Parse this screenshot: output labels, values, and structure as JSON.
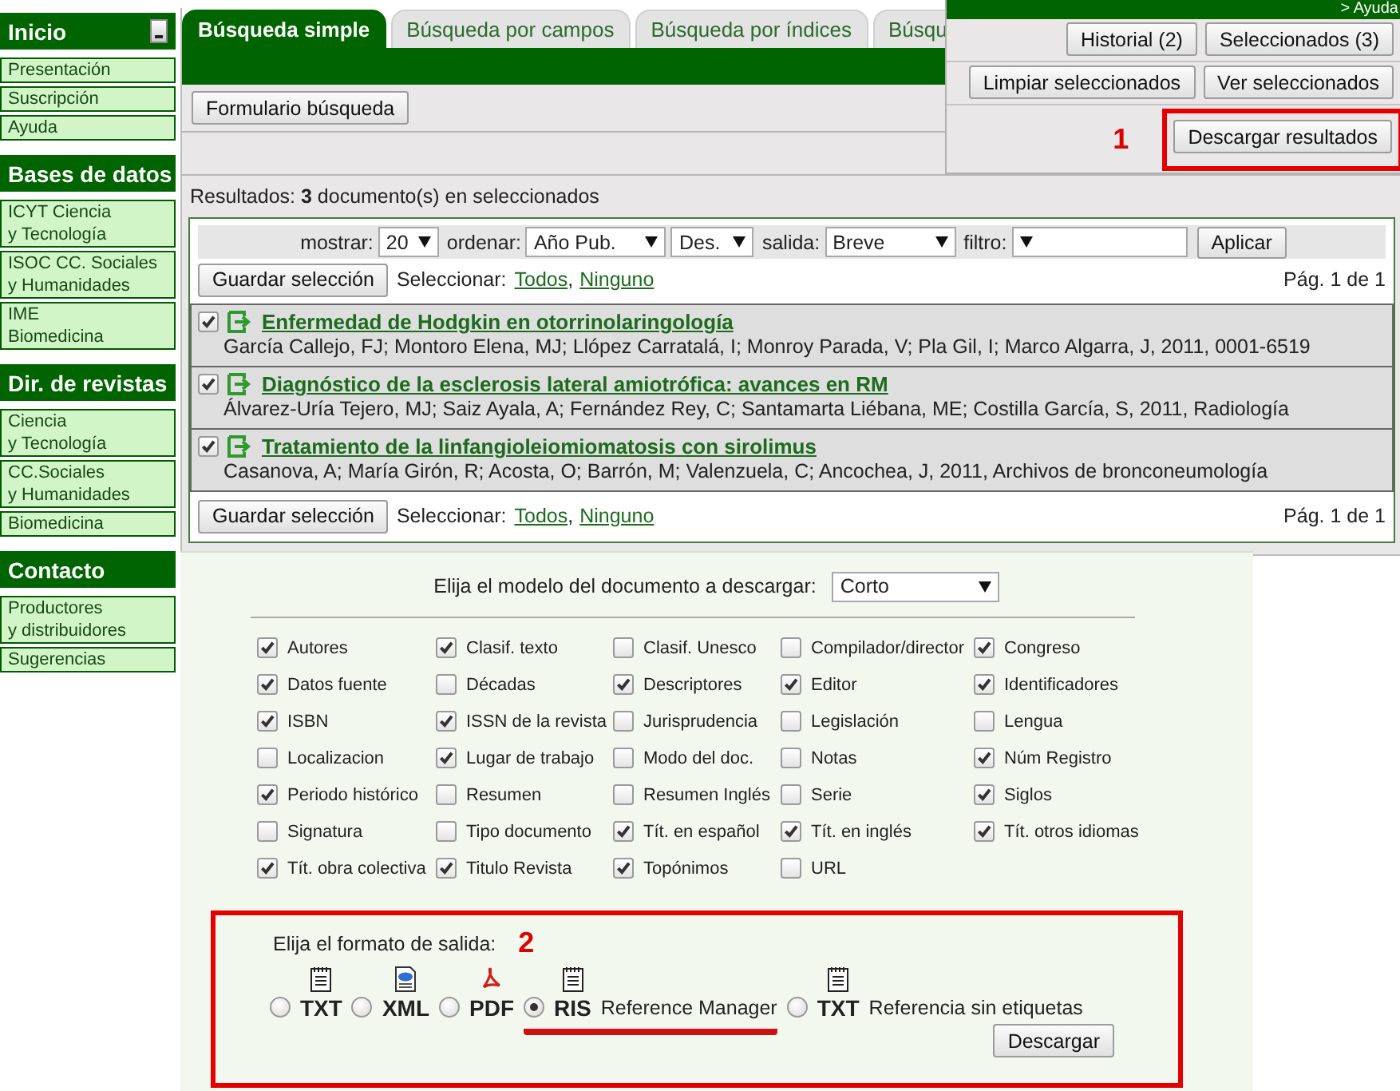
{
  "sidebar": [
    {
      "title": "Inicio",
      "collapsible": true,
      "items": [
        {
          "lines": [
            "Presentación"
          ]
        },
        {
          "lines": [
            "Suscripción"
          ]
        },
        {
          "lines": [
            "Ayuda"
          ]
        }
      ]
    },
    {
      "title": "Bases de datos",
      "collapsible": false,
      "items": [
        {
          "lines": [
            "ICYT Ciencia",
            "y Tecnología"
          ]
        },
        {
          "lines": [
            "ISOC CC. Sociales",
            "y Humanidades"
          ]
        },
        {
          "lines": [
            "IME",
            "Biomedicina"
          ]
        }
      ]
    },
    {
      "title": "Dir. de revistas",
      "collapsible": false,
      "items": [
        {
          "lines": [
            "Ciencia",
            "y Tecnología"
          ]
        },
        {
          "lines": [
            "CC.Sociales",
            "y Humanidades"
          ]
        },
        {
          "lines": [
            "Biomedicina"
          ]
        }
      ]
    },
    {
      "title": "Contacto",
      "collapsible": false,
      "items": [
        {
          "lines": [
            "Productores",
            "y distribuidores"
          ]
        },
        {
          "lines": [
            "Sugerencias"
          ]
        }
      ]
    }
  ],
  "tabs": [
    {
      "label": "Búsqueda simple",
      "selected": true
    },
    {
      "label": "Búsqueda por campos",
      "selected": false
    },
    {
      "label": "Búsqueda por índices",
      "selected": false
    },
    {
      "label": "Búsqu",
      "selected": false
    }
  ],
  "search_toolbar": {
    "button": "Formulario búsqueda"
  },
  "account_panel": {
    "help_link": "> Ayuda",
    "buttons": [
      "Historial (2)",
      "Seleccionados (3)",
      "Limpiar seleccionados",
      "Ver seleccionados"
    ],
    "step": "1",
    "download_button": "Descargar resultados"
  },
  "results": {
    "summary": "Resultados: **3** documento(s) en seleccionados",
    "controls": [
      {
        "label": "mostrar:",
        "value": "20"
      },
      {
        "label": "ordenar:",
        "value": "Año Pub."
      },
      {
        "value": "Des."
      },
      {
        "label": "salida:",
        "value": "Breve"
      },
      {
        "label": "filtro:"
      }
    ],
    "apply_button": "Aplicar",
    "selection_bars": [
      {
        "save_button": "Guardar selección",
        "select_label": "Seleccionar:",
        "links": [
          "Todos",
          "Ninguno"
        ],
        "separator": ",",
        "page": "Pág. 1 de 1"
      },
      {
        "save_button": "Guardar selección",
        "select_label": "Seleccionar:",
        "links": [
          "Todos",
          "Ninguno"
        ],
        "separator": ",",
        "page": "Pág. 1 de 1"
      }
    ],
    "records": [
      {
        "checked": true,
        "title": "Enfermedad de Hodgkin en otorrinolaringología",
        "details": "García Callejo, FJ; Montoro Elena, MJ; Llópez Carratalá, I; Monroy Parada, V; Pla Gil, I; Marco Algarra, J,  2011,  0001-6519"
      },
      {
        "checked": true,
        "title": "Diagnóstico de la esclerosis lateral amiotrófica: avances en RM",
        "details": "Álvarez-Uría Tejero, MJ; Saiz Ayala, A; Fernández Rey, C; Santamarta Liébana, ME; Costilla García, S,  2011,  Radiología"
      },
      {
        "checked": true,
        "title": "Tratamiento de la linfangioleiomiomatosis con sirolimus",
        "details": "Casanova, A; María Girón, R; Acosta, O; Barrón, M; Valenzuela, C; Ancochea, J,  2011,  Archivos de bronconeumología"
      }
    ]
  },
  "download": {
    "model_label": "Elija el modelo del documento a descargar:",
    "model_value": "Corto",
    "fields": [
      {
        "label": "Autores",
        "checked": true
      },
      {
        "label": "Clasif. texto",
        "checked": true
      },
      {
        "label": "Clasif. Unesco",
        "checked": false
      },
      {
        "label": "Compilador/director",
        "checked": false
      },
      {
        "label": "Congreso",
        "checked": true
      },
      {
        "label": "Datos fuente",
        "checked": true
      },
      {
        "label": "Décadas",
        "checked": false
      },
      {
        "label": "Descriptores",
        "checked": true
      },
      {
        "label": "Editor",
        "checked": true
      },
      {
        "label": "Identificadores",
        "checked": true
      },
      {
        "label": "ISBN",
        "checked": true
      },
      {
        "label": "ISSN de la revista",
        "checked": true
      },
      {
        "label": "Jurisprudencia",
        "checked": false
      },
      {
        "label": "Legislación",
        "checked": false
      },
      {
        "label": "Lengua",
        "checked": false
      },
      {
        "label": "Localizacion",
        "checked": false
      },
      {
        "label": "Lugar de trabajo",
        "checked": true
      },
      {
        "label": "Modo del doc.",
        "checked": false
      },
      {
        "label": "Notas",
        "checked": false
      },
      {
        "label": "Núm Registro",
        "checked": true
      },
      {
        "label": "Periodo histórico",
        "checked": true
      },
      {
        "label": "Resumen",
        "checked": false
      },
      {
        "label": "Resumen Inglés",
        "checked": false
      },
      {
        "label": "Serie",
        "checked": false
      },
      {
        "label": "Siglos",
        "checked": true
      },
      {
        "label": "Signatura",
        "checked": false
      },
      {
        "label": "Tipo documento",
        "checked": false
      },
      {
        "label": "Tít. en español",
        "checked": true
      },
      {
        "label": "Tít. en inglés",
        "checked": true
      },
      {
        "label": "Tít. otros idiomas",
        "checked": true
      },
      {
        "label": "Tít. obra colectiva",
        "checked": true
      },
      {
        "label": "Titulo Revista",
        "checked": true
      },
      {
        "label": "Topónimos",
        "checked": true
      },
      {
        "label": "URL",
        "checked": false
      }
    ],
    "format": {
      "label": "Elija el formato de salida:",
      "step": "2",
      "options": [
        {
          "kind": "text",
          "code": "TXT",
          "selected": false,
          "highlighted": false
        },
        {
          "kind": "xml",
          "code": "XML",
          "selected": false,
          "highlighted": false
        },
        {
          "kind": "pdf",
          "code": "PDF",
          "selected": false,
          "highlighted": false
        },
        {
          "kind": "text",
          "code": "RIS",
          "description": "Reference Manager",
          "selected": true,
          "highlighted": true
        },
        {
          "kind": "text",
          "code": "TXT",
          "description": "Referencia sin etiquetas",
          "selected": false,
          "highlighted": false
        }
      ],
      "button": "Descargar"
    }
  }
}
